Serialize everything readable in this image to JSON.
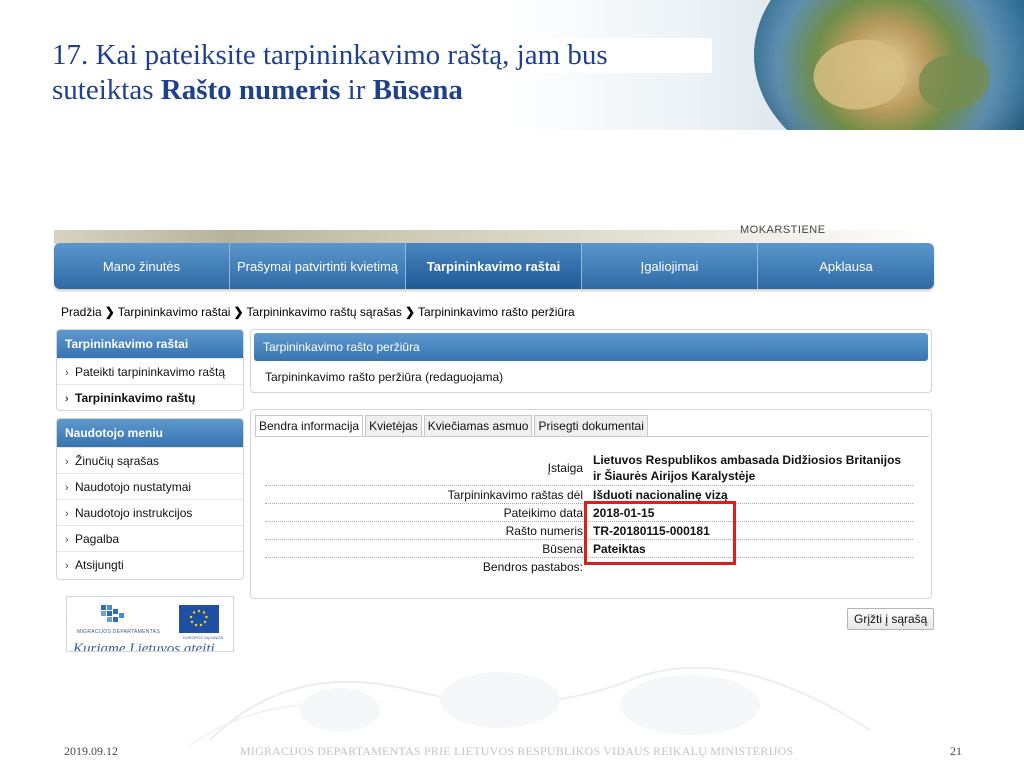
{
  "slide": {
    "title_line1": "17. Kai pateiksite tarpininkavimo raštą, jam bus",
    "title_line2_plain1": "suteiktas ",
    "title_line2_bold1": "Rašto numeris",
    "title_line2_plain2": " ir ",
    "title_line2_bold2": "Būsena",
    "footer_date": "2019.09.12",
    "footer_org": "MIGRACIJOS DEPARTAMENTAS PRIE LIETUVOS RESPUBLIKOS VIDAUS REIKALŲ MINISTERIJOS",
    "page_number": "21"
  },
  "screenshot": {
    "user_name_cut": "MOKARSTIENE",
    "nav": [
      {
        "label": "Mano žinutės",
        "active": false
      },
      {
        "label": "Prašymai patvirtinti kvietimą",
        "active": false
      },
      {
        "label": "Tarpininkavimo raštai",
        "active": true
      },
      {
        "label": "Įgaliojimai",
        "active": false
      },
      {
        "label": "Apklausa",
        "active": false
      }
    ],
    "breadcrumb": [
      "Pradžia",
      "Tarpininkavimo raštai",
      "Tarpininkavimo raštų sąrašas",
      "Tarpininkavimo rašto peržiūra"
    ],
    "sidebar_a": {
      "title": "Tarpininkavimo raštai",
      "items": [
        "Pateikti tarpininkavimo raštą",
        "Tarpininkavimo raštų sąrašas"
      ]
    },
    "sidebar_b": {
      "title": "Naudotojo meniu",
      "items": [
        "Žinučių sąrašas",
        "Naudotojo nustatymai",
        "Naudotojo instrukcijos",
        "Pagalba",
        "Atsijungti"
      ]
    },
    "logo": {
      "org_text": "MIGRACIJOS DEPARTAMENTAS",
      "eu_text": "EUROPOS SĄJUNGA",
      "slogan": "Kuriame Lietuvos ateitį"
    },
    "view_panel": {
      "title": "Tarpininkavimo rašto peržiūra",
      "subtitle": "Tarpininkavimo rašto peržiūra (redaguojama)"
    },
    "tabs": [
      "Bendra informacija",
      "Kvietėjas",
      "Kviečiamas asmuo",
      "Prisegti dokumentai"
    ],
    "details": {
      "institution_label": "Įstaiga",
      "institution_value": "Lietuvos Respublikos ambasada Didžiosios Britanijos ir Šiaurės Airijos Karalystėje",
      "reason_label": "Tarpininkavimo raštas dėl",
      "reason_value": "Išduoti nacionalinę vizą",
      "date_label": "Pateikimo data",
      "date_value": "2018-01-15",
      "number_label": "Rašto numeris",
      "number_value": "TR-20180115-000181",
      "status_label": "Būsena",
      "status_value": "Pateiktas",
      "notes_label": "Bendros pastabos:",
      "notes_value": ""
    },
    "back_button": "Grįžti į sąrašą"
  },
  "colors": {
    "title": "#1f3f8f",
    "nav_blue": "#3775b2",
    "highlight_red": "#e01c1c"
  }
}
